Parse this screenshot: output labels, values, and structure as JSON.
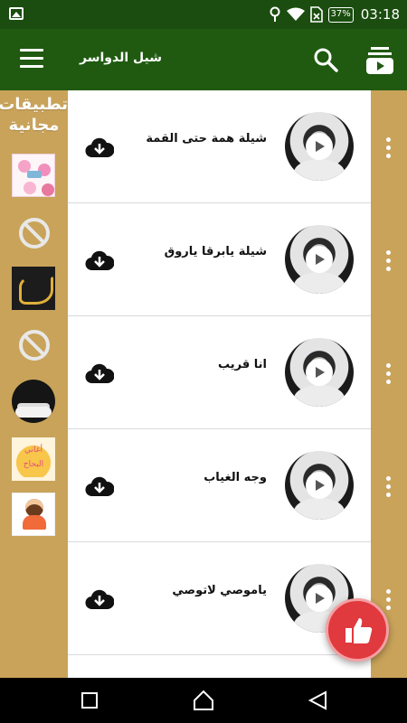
{
  "status_bar": {
    "battery": "37%",
    "time": "03:18"
  },
  "app_bar": {
    "title": "شيل الدواسر"
  },
  "sidebar": {
    "title": "تطبيقات مجانية",
    "apps": [
      {
        "icon": "floral-app-icon"
      },
      {
        "icon": "blocked-icon"
      },
      {
        "icon": "calligraphy-app-icon"
      },
      {
        "icon": "blocked-icon"
      },
      {
        "icon": "clouds-app-icon"
      },
      {
        "icon": "songs-app-icon",
        "text": "أغاني البحاح"
      },
      {
        "icon": "girl-app-icon"
      }
    ]
  },
  "tracks": [
    {
      "title": "شيلة همة حتى القمة"
    },
    {
      "title": "شيلة يابرقا ياروق"
    },
    {
      "title": "انا قريب"
    },
    {
      "title": "وجه الغياب"
    },
    {
      "title": "ياموصي لاتوصي"
    }
  ],
  "colors": {
    "status_bar": "#1a4d0f",
    "app_bar": "#1f5a10",
    "side_panel": "#c9a35a",
    "fab": "#e0393e"
  }
}
